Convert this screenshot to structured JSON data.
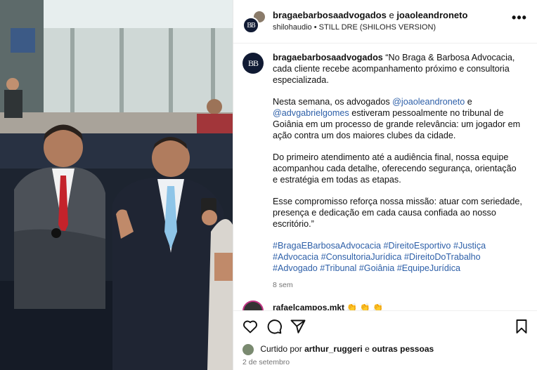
{
  "post": {
    "photo_alt": "",
    "header": {
      "author1": "bragaebarbosaadvogados",
      "conjunction": "e",
      "author2": "joaoleandroneto",
      "audio": "shilohaudio • STILL DRE (SHILOHS VERSION)",
      "avatar_initials": "BB"
    },
    "caption": {
      "username": "bragaebarbosaadvogados",
      "p1": "“No Braga & Barbosa Advocacia, cada cliente recebe acompanhamento próximo e consultoria especializada.",
      "p2_a": "Nesta semana, os advogados ",
      "mention1": "@joaoleandroneto",
      "p2_b": " e ",
      "mention2": "@advgabrielgomes",
      "p2_c": " estiveram pessoalmente no tribunal de Goiânia em um processo de grande relevância: um jogador em ação contra um dos maiores clubes da cidade.",
      "p3": "Do primeiro atendimento até a audiência final, nossa equipe acompanhou cada detalhe, oferecendo segurança, orientação e estratégia em todas as etapas.",
      "p4": "Esse compromisso reforça nossa missão: atuar com seriedade, presença e dedicação em cada causa confiada ao nosso escritório.”",
      "hashtags": [
        "#BragaEBarbosaAdvocacia",
        "#DireitoEsportivo",
        "#Justiça",
        "#Advocacia",
        "#ConsultoriaJurídica",
        "#DireitoDoTrabalho",
        "#Advogado",
        "#Tribunal",
        "#Goiânia",
        "#EquipeJurídica"
      ],
      "time": "8 sem"
    },
    "next_comment": {
      "username": "rafaelcampos.mkt",
      "text": "👏 👏 👏"
    },
    "actions": {
      "like_icon": "heart-icon",
      "comment_icon": "comment-icon",
      "share_icon": "send-icon",
      "save_icon": "bookmark-icon"
    },
    "likes": {
      "prefix": "Curtido por",
      "user": "arthur_ruggeri",
      "middle": "e",
      "rest": "outras pessoas"
    },
    "date": "2 de setembro"
  },
  "colors": {
    "link": "#2d5fa8",
    "muted": "#737373",
    "suit": "#2a2f3a",
    "tie_red": "#c4232b",
    "tie_blue": "#8ec5e8"
  }
}
